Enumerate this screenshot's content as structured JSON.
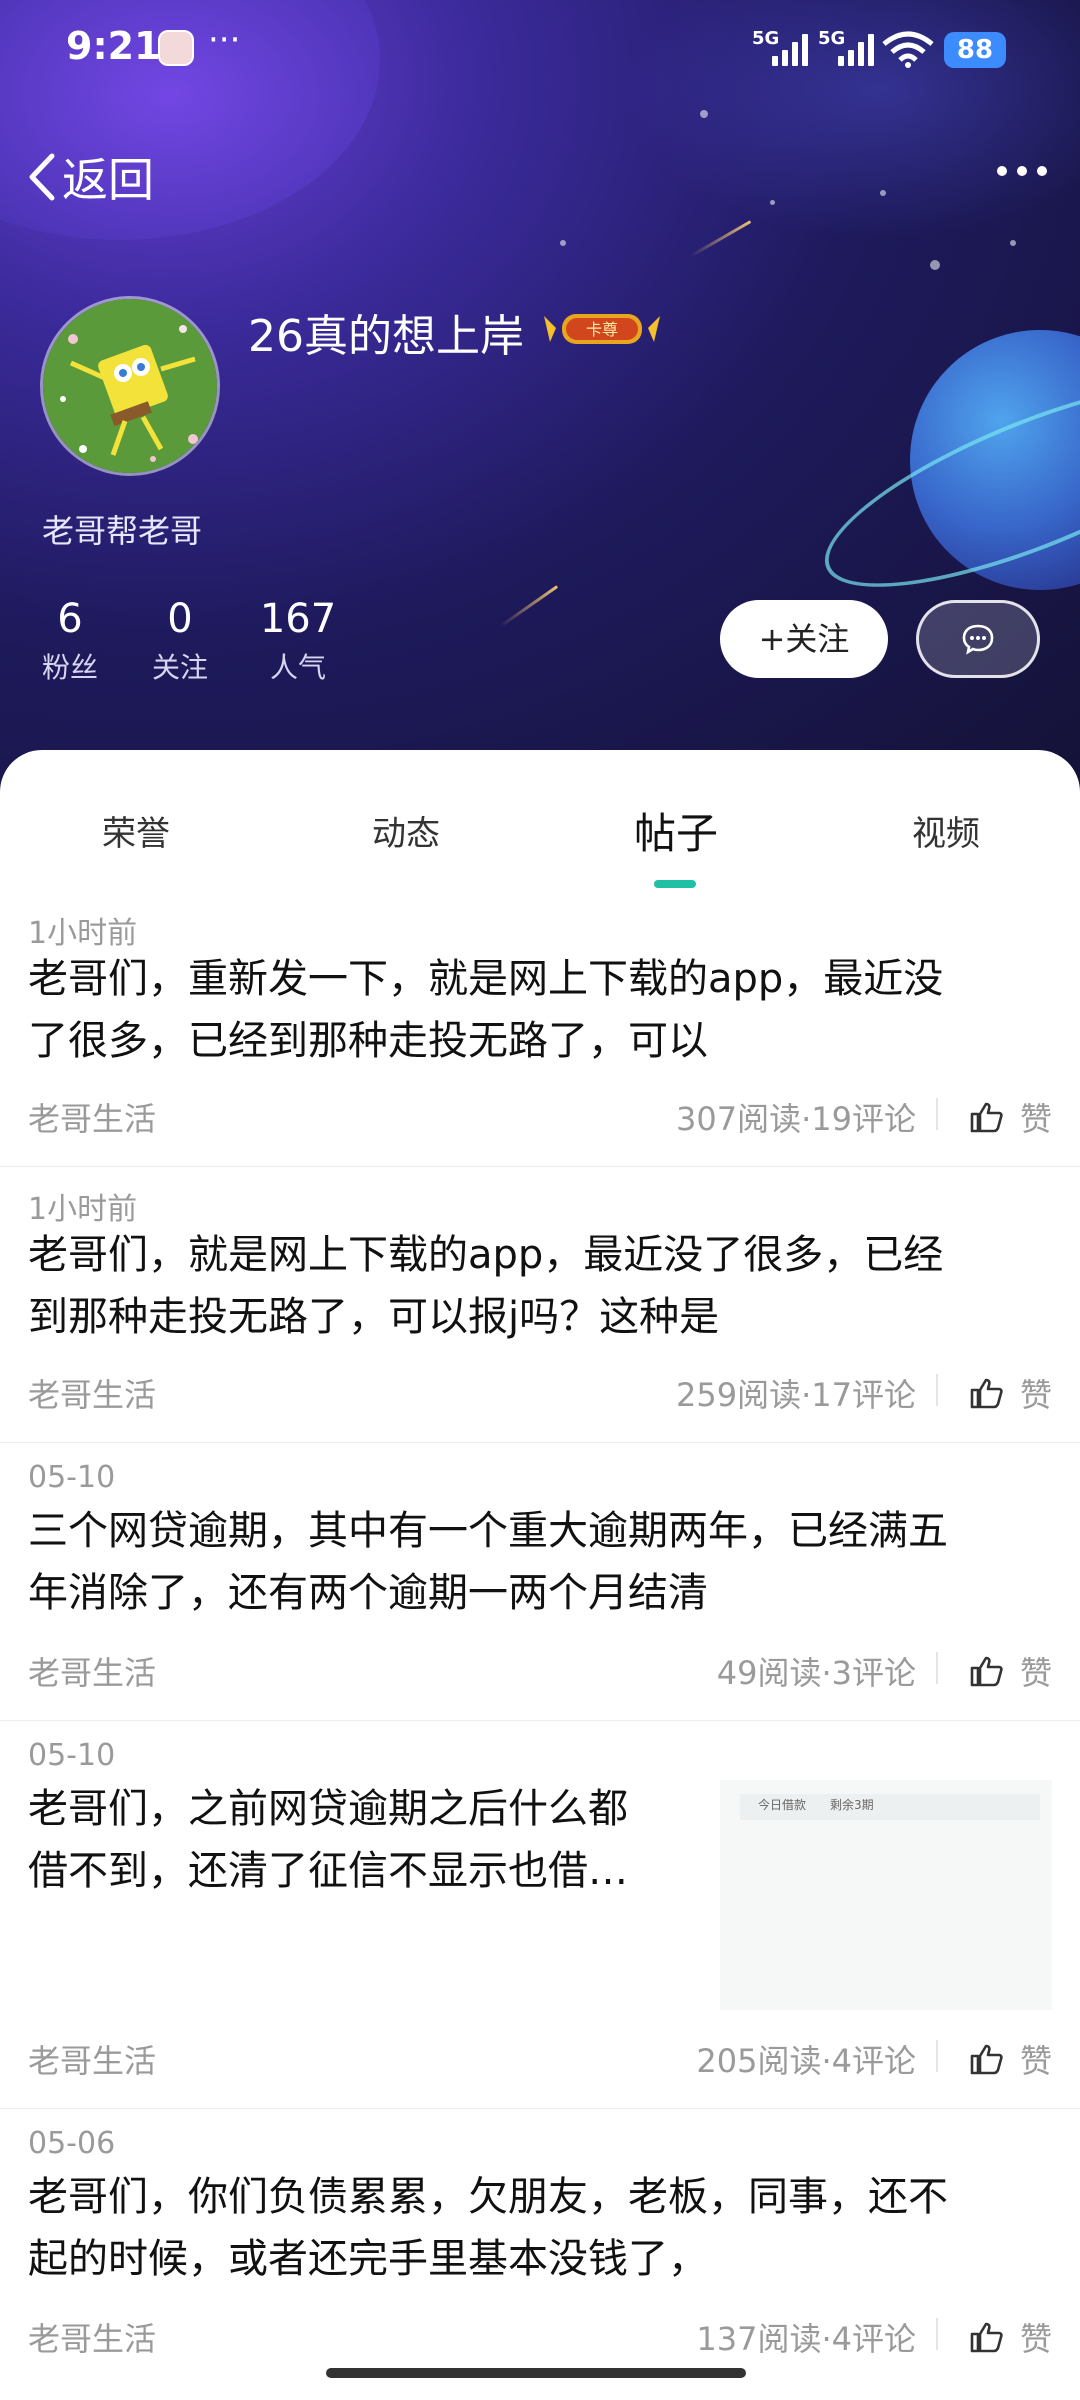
{
  "status_bar": {
    "time": "9:21",
    "dots": "···",
    "net1": "5G",
    "net2": "5G",
    "battery": "88"
  },
  "nav": {
    "back_label": "返回",
    "more_icon": "more-icon"
  },
  "profile": {
    "username": "26真的想上岸",
    "badge_text": "卡尊",
    "bio": "老哥帮老哥",
    "stats": [
      {
        "value": "6",
        "label": "粉丝"
      },
      {
        "value": "0",
        "label": "关注"
      },
      {
        "value": "167",
        "label": "人气"
      }
    ],
    "follow_label": "+关注",
    "message_icon": "chat-bubble-icon"
  },
  "tabs": [
    {
      "label": "荣誉",
      "active": false
    },
    {
      "label": "动态",
      "active": false
    },
    {
      "label": "帖子",
      "active": true
    },
    {
      "label": "视频",
      "active": false
    }
  ],
  "posts": [
    {
      "time": "1小时前",
      "title_lines": [
        "老哥们，重新发一下，就是网上下载的app，最近没",
        "了很多，已经到那种走投无路了，可以"
      ],
      "category": "老哥生活",
      "counts": "307阅读·19评论",
      "like_label": "赞"
    },
    {
      "time": "1小时前",
      "title_lines": [
        "老哥们，就是网上下载的app，最近没了很多，已经",
        "到那种走投无路了，可以报j吗？这种是"
      ],
      "category": "老哥生活",
      "counts": "259阅读·17评论",
      "like_label": "赞"
    },
    {
      "time": "05-10",
      "title_lines": [
        "三个网贷逾期，其中有一个重大逾期两年，已经满五",
        "年消除了，还有两个逾期一两个月结清"
      ],
      "category": "老哥生活",
      "counts": "49阅读·3评论",
      "like_label": "赞"
    },
    {
      "time": "05-10",
      "title_lines": [
        "老哥们，之前网贷逾期之后什么都",
        "借不到，还清了征信不显示也借…"
      ],
      "category": "老哥生活",
      "counts": "205阅读·4评论",
      "like_label": "赞",
      "thumb_text1": "今日借款",
      "thumb_text2": "剩余3期"
    },
    {
      "time": "05-06",
      "title_lines": [
        "老哥们，你们负债累累，欠朋友，老板，同事，还不",
        "起的时候，或者还完手里基本没钱了，"
      ],
      "category": "老哥生活",
      "counts": "137阅读·4评论",
      "like_label": "赞"
    }
  ]
}
